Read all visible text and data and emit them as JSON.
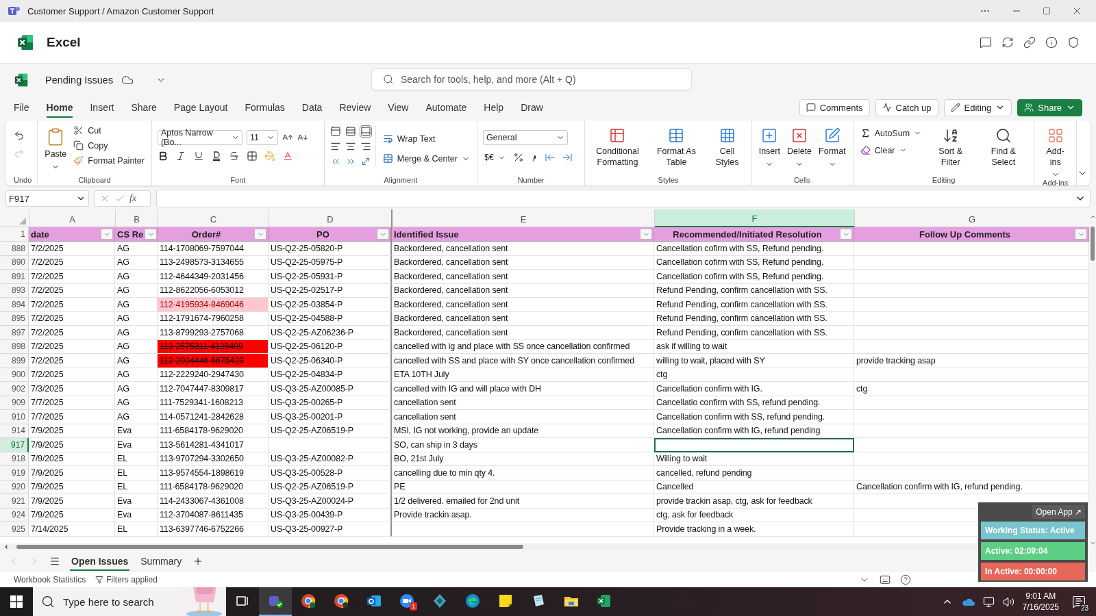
{
  "window": {
    "title": "Customer Support / Amazon Customer Support"
  },
  "app": {
    "name": "Excel"
  },
  "document": {
    "name": "Pending Issues"
  },
  "search": {
    "placeholder": "Search for tools, help, and more (Alt + Q)"
  },
  "tabs": [
    {
      "label": "File",
      "selected": false
    },
    {
      "label": "Home",
      "selected": true
    },
    {
      "label": "Insert",
      "selected": false
    },
    {
      "label": "Share",
      "selected": false
    },
    {
      "label": "Page Layout",
      "selected": false
    },
    {
      "label": "Formulas",
      "selected": false
    },
    {
      "label": "Data",
      "selected": false
    },
    {
      "label": "Review",
      "selected": false
    },
    {
      "label": "View",
      "selected": false
    },
    {
      "label": "Automate",
      "selected": false
    },
    {
      "label": "Help",
      "selected": false
    },
    {
      "label": "Draw",
      "selected": false
    }
  ],
  "actions": [
    {
      "label": "Comments",
      "kind": "outline"
    },
    {
      "label": "Catch up",
      "kind": "outline"
    },
    {
      "label": "Editing",
      "kind": "outline"
    },
    {
      "label": "Share",
      "kind": "primary"
    }
  ],
  "ribbon": {
    "undo": {
      "label": "Undo"
    },
    "clipboard": {
      "label": "Clipboard",
      "paste": "Paste",
      "cut": "Cut",
      "copy": "Copy",
      "format_painter": "Format Painter"
    },
    "font": {
      "label": "Font",
      "font_name": "Aptos Narrow (Bo...",
      "font_size": "11"
    },
    "alignment": {
      "label": "Alignment",
      "wrap_text": "Wrap Text",
      "merge_center": "Merge & Center"
    },
    "number": {
      "label": "Number",
      "format": "General",
      "currency": "$€"
    },
    "styles": {
      "label": "Styles",
      "conditional_formatting": "Conditional Formatting",
      "format_as_table": "Format As Table",
      "cell_styles": "Cell Styles"
    },
    "cells": {
      "label": "Cells",
      "insert": "Insert",
      "delete": "Delete",
      "format": "Format"
    },
    "editing": {
      "label": "Editing",
      "autosum": "AutoSum",
      "clear": "Clear",
      "sort_filter": "Sort & Filter",
      "find_select": "Find & Select"
    },
    "addins": {
      "label": "Add-ins",
      "add_ins": "Add-ins"
    }
  },
  "formula_bar": {
    "cell": "F917",
    "function_label": "fx"
  },
  "columns": [
    {
      "letter": "A",
      "header": "date",
      "selected": false
    },
    {
      "letter": "B",
      "header": "CS Re",
      "selected": false
    },
    {
      "letter": "C",
      "header": "Order#",
      "selected": false
    },
    {
      "letter": "D",
      "header": "PO",
      "selected": false
    },
    {
      "letter": "E",
      "header": "Identified Issue",
      "selected": false
    },
    {
      "letter": "F",
      "header": "Recommended/Initiated Resolution",
      "selected": true
    },
    {
      "letter": "G",
      "header": "Follow Up Comments",
      "selected": false
    }
  ],
  "header_row": "1",
  "rows": [
    {
      "number": "888",
      "date": "7/2/2025",
      "rep": "AG",
      "order": "114-1708069-7597044",
      "po": "US-Q2-25-05820-P",
      "issue": "Backordered, cancellation sent",
      "resolution": "Cancellation cofirm with SS, Refund pending.",
      "selected": false
    },
    {
      "number": "890",
      "date": "7/2/2025",
      "rep": "AG",
      "order": "113-2498573-3134655",
      "po": "US-Q2-25-05975-P",
      "issue": "Backordered, cancellation sent",
      "resolution": "Cancellation cofirm with SS, Refund pending.",
      "selected": false
    },
    {
      "number": "891",
      "date": "7/2/2025",
      "rep": "AG",
      "order": "112-4644349-2031456",
      "po": "US-Q2-25-05931-P",
      "issue": "Backordered, cancellation sent",
      "resolution": "Cancellation cofirm with SS, Refund pending.",
      "selected": false
    },
    {
      "number": "893",
      "date": "7/2/2025",
      "rep": "AG",
      "order": "112-8622056-6053012",
      "po": "US-Q2-25-02517-P",
      "issue": "Backordered, cancellation sent",
      "resolution": "Refund Pending, confirm cancellation with SS.",
      "selected": false
    },
    {
      "number": "894",
      "date": "7/2/2025",
      "rep": "AG",
      "order": {
        "text": "112-4195934-8469046",
        "color": "#ffc7ce"
      },
      "po": "US-Q2-25-03854-P",
      "issue": "Backordered, cancellation sent",
      "resolution": "Refund Pending, confirm cancellation with SS.",
      "selected": false
    },
    {
      "number": "895",
      "date": "7/2/2025",
      "rep": "AG",
      "order": "112-1791674-7960258",
      "po": "US-Q2-25-04588-P",
      "issue": "Backordered, cancellation sent",
      "resolution": "Refund Pending, confirm cancellation with SS.",
      "selected": false
    },
    {
      "number": "897",
      "date": "7/2/2025",
      "rep": "AG",
      "order": "113-8799293-2757068",
      "po": "US-Q2-25-AZ06236-P",
      "issue": "Backordered, cancellation sent",
      "resolution": "Refund Pending, confirm cancellation with SS.",
      "selected": false
    },
    {
      "number": "898",
      "date": "7/2/2025",
      "rep": "AG",
      "order": {
        "text": "113-2575311-4139409",
        "color": "#ff0000",
        "struck": true
      },
      "po": "US-Q2-25-06120-P",
      "issue": "cancelled with ig and place with SS once cancellation confirmed",
      "resolution": "ask if willing to wait",
      "selected": false
    },
    {
      "number": "899",
      "date": "7/2/2025",
      "rep": "AG",
      "order": {
        "text": "112-2004446-6675423",
        "color": "#ff0000",
        "struck": true
      },
      "po": "US-Q2-25-06340-P",
      "issue": "cancelled with SS and place with SY once cancellation confirmed",
      "resolution": "willing to wait, placed with SY",
      "follow_up": "provide tracking asap",
      "selected": false
    },
    {
      "number": "900",
      "date": "7/2/2025",
      "rep": "AG",
      "order": "112-2229240-2947430",
      "po": "US-Q2-25-04834-P",
      "issue": "ETA 10TH July",
      "resolution": "ctg",
      "selected": false
    },
    {
      "number": "902",
      "date": "7/3/2025",
      "rep": "AG",
      "order": "112-7047447-8309817",
      "po": "US-Q3-25-AZ00085-P",
      "issue": "cancelled with IG and will place with DH",
      "resolution": "Cancellation confirm with IG.",
      "follow_up": "ctg",
      "selected": false
    },
    {
      "number": "909",
      "date": "7/7/2025",
      "rep": "AG",
      "order": "111-7529341-1608213",
      "po": "US-Q3-25-00265-P",
      "issue": "cancellation sent",
      "resolution": "Cancellatio confirm with SS, refund pending.",
      "selected": false
    },
    {
      "number": "910",
      "date": "7/7/2025",
      "rep": "AG",
      "order": "114-0571241-2842628",
      "po": "US-Q3-25-00201-P",
      "issue": "cancellation sent",
      "resolution": "Cancellation confirm with SS, refund pending.",
      "selected": false
    },
    {
      "number": "914",
      "date": "7/9/2025",
      "rep": "Eva",
      "order": "111-6584178-9629020",
      "po": "US-Q2-25-AZ06519-P",
      "issue": "MSI, IG not working, provide an update",
      "resolution": "Cancellation confirm with IG, refund pending",
      "selected": false
    },
    {
      "number": "917",
      "date": "7/9/2025",
      "rep": "Eva",
      "order": "113-5614281-4341017",
      "issue": "SO, can ship in 3 days",
      "selected": true
    },
    {
      "number": "918",
      "date": "7/9/2025",
      "rep": "EL",
      "order": "113-9707294-3302650",
      "po": "US-Q3-25-AZ00082-P",
      "issue": "BO, 21st July",
      "resolution": "Willing to wait",
      "selected": false
    },
    {
      "number": "919",
      "date": "7/9/2025",
      "rep": "EL",
      "order": "113-9574554-1898619",
      "po": "US-Q3-25-00528-P",
      "issue": "cancelling due to min qty 4.",
      "resolution": "cancelled, refund pending",
      "selected": false
    },
    {
      "number": "920",
      "date": "7/9/2025",
      "rep": "EL",
      "order": "111-6584178-9629020",
      "po": "US-Q2-25-AZ06519-P",
      "issue": "PE",
      "resolution": "Cancelled",
      "follow_up": "Cancellation confirm with IG, refund pending.",
      "selected": false
    },
    {
      "number": "921",
      "date": "7/9/2025",
      "rep": "Eva",
      "order": "114-2433067-4361008",
      "po": "US-Q3-25-AZ00024-P",
      "issue": "1/2 delivered. emailed for 2nd unit",
      "resolution": "provide trackin asap, ctg, ask for feedback",
      "selected": false
    },
    {
      "number": "924",
      "date": "7/9/2025",
      "rep": "Eva",
      "order": "112-3704087-8611435",
      "po": "US-Q3-25-00439-P",
      "issue": "Provide trackin asap.",
      "resolution": "ctg, ask for feedback",
      "selected": false
    },
    {
      "number": "925",
      "date": "7/14/2025",
      "rep": "EL",
      "order": "113-6397746-6752266",
      "po": "US-Q3-25-00927-P",
      "resolution": "Provide tracking in a week.",
      "selected": false
    }
  ],
  "sheets": [
    {
      "label": "Open Issues",
      "selected": true
    },
    {
      "label": "Summary",
      "selected": false
    }
  ],
  "status_bar": {
    "items": [
      "Workbook Statistics",
      "Filters applied"
    ]
  },
  "tracker": {
    "button": "Open App ↗",
    "statuses": [
      {
        "label": "Working Status: Active",
        "color": "#79c5cd"
      },
      {
        "label": "Active: 02:09:04",
        "color": "#5ccf85"
      },
      {
        "label": "In Active: 00:00:00",
        "color": "#e6685a"
      }
    ]
  },
  "taskbar": {
    "search_placeholder": "Type here to search",
    "badge": "1",
    "time": "9:01 AM",
    "date": "7/16/2025",
    "notifications": "23"
  }
}
